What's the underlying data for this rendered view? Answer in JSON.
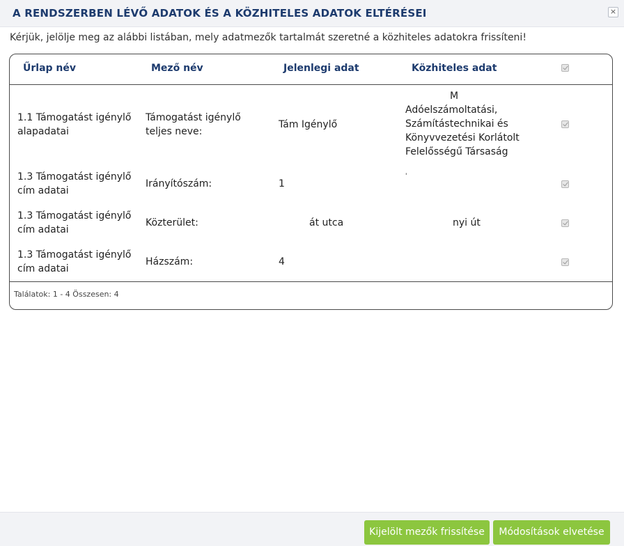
{
  "dialog": {
    "title": "A RENDSZERBEN LÉVŐ ADATOK ÉS A KÖZHITELES ADATOK ELTÉRÉSEI",
    "close_glyph": "×",
    "intro": "Kérjük, jelölje meg az alábbi listában, mely adatmezők tartalmát szeretné a közhiteles adatokra frissíteni!"
  },
  "table": {
    "headers": {
      "form": "Űrlap név",
      "field": "Mező név",
      "current": "Jelenlegi adat",
      "authentic": "Közhiteles adat"
    },
    "header_checkbox_checked": true,
    "rows": [
      {
        "form": "1.1 Támogatást igénylő alapadatai",
        "field": "Támogatást igénylő teljes neve:",
        "current": "Tám Igénylő",
        "authentic_lines": [
          "M",
          "Adóelszámoltatási,",
          "Számítástechnikai és",
          "Könyvvezetési Korlátolt",
          "Felelősségű Társaság"
        ],
        "checked": true
      },
      {
        "form": "1.3 Támogatást igénylő cím adatai",
        "field": "Irányítószám:",
        "current": "1",
        "authentic": "'",
        "checked": true
      },
      {
        "form": "1.3 Támogatást igénylő cím adatai",
        "field": "Közterület:",
        "current": "át utca",
        "authentic": "nyi út",
        "checked": true
      },
      {
        "form": "1.3 Támogatást igénylő cím adatai",
        "field": "Házszám:",
        "current": "4",
        "authentic": "",
        "checked": true
      }
    ],
    "footer": "Találatok: 1 - 4 Összesen: 4"
  },
  "actions": {
    "refresh_label": "Kijelölt mezők frissítése",
    "discard_label": "Módosítások elvetése"
  },
  "colors": {
    "title": "#1d3b6e",
    "button": "#8cc63f",
    "bar": "#f2f3f6"
  }
}
